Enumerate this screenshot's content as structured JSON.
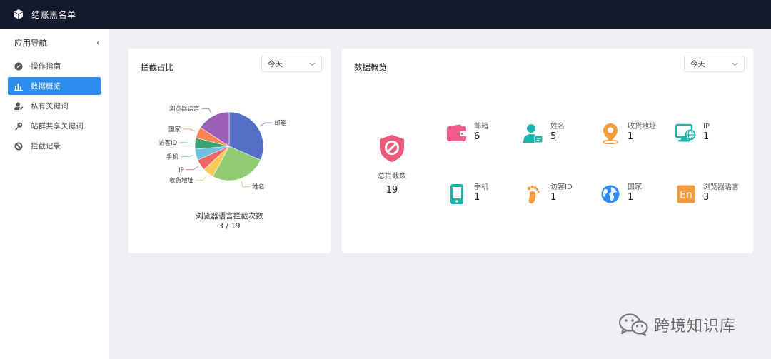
{
  "app": {
    "title": "结账黑名单"
  },
  "sidebar": {
    "heading": "应用导航",
    "items": [
      {
        "label": "操作指南",
        "icon": "compass-icon"
      },
      {
        "label": "数据概览",
        "icon": "bar-chart-icon",
        "active": true
      },
      {
        "label": "私有关键词",
        "icon": "user-edit-icon"
      },
      {
        "label": "站群共享关键词",
        "icon": "key-icon"
      },
      {
        "label": "拦截记录",
        "icon": "ban-icon"
      }
    ]
  },
  "intercept": {
    "title": "拦截占比",
    "range_select": "今天",
    "caption_label": "浏览器语言拦截次数",
    "caption_value": "3 / 19"
  },
  "overview": {
    "title": "数据概览",
    "range_select": "今天",
    "total_label": "总拦截数",
    "total_value": "19",
    "stats": [
      {
        "label": "邮箱",
        "value": "6",
        "icon": "wallet-icon",
        "color": "#f25c8a"
      },
      {
        "label": "姓名",
        "value": "5",
        "icon": "user-card-icon",
        "color": "#1bb5b0"
      },
      {
        "label": "收货地址",
        "value": "1",
        "icon": "location-pin-icon",
        "color": "#f49b3f"
      },
      {
        "label": "IP",
        "value": "1",
        "icon": "monitor-globe-icon",
        "color": "#1bb5b0"
      },
      {
        "label": "手机",
        "value": "1",
        "icon": "phone-icon",
        "color": "#1bb5b0"
      },
      {
        "label": "访客ID",
        "value": "1",
        "icon": "footprint-icon",
        "color": "#f49b3f"
      },
      {
        "label": "国家",
        "value": "1",
        "icon": "globe-icon",
        "color": "#2d8cf0"
      },
      {
        "label": "浏览器语言",
        "value": "3",
        "icon": "language-en-icon",
        "color": "#f49b3f"
      }
    ]
  },
  "chart_data": {
    "type": "pie",
    "title": "",
    "slices": [
      {
        "label": "邮箱",
        "value": 6,
        "color": "#5470c6"
      },
      {
        "label": "姓名",
        "value": 5,
        "color": "#91cc75"
      },
      {
        "label": "收货地址",
        "value": 1,
        "color": "#fac858"
      },
      {
        "label": "IP",
        "value": 1,
        "color": "#ee6666"
      },
      {
        "label": "手机",
        "value": 1,
        "color": "#73c0de"
      },
      {
        "label": "访客ID",
        "value": 1,
        "color": "#3ba272"
      },
      {
        "label": "国家",
        "value": 1,
        "color": "#fc8452"
      },
      {
        "label": "浏览器语言",
        "value": 3,
        "color": "#9a60b4"
      }
    ],
    "total": 19
  },
  "watermark": {
    "text": "跨境知识库"
  }
}
